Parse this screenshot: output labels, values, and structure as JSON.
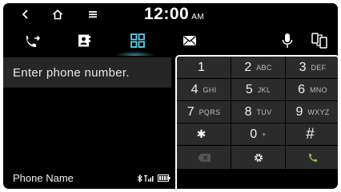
{
  "status_bar": {
    "back_icon": "chevron-left-icon",
    "home_icon": "home-icon",
    "menu_icon": "menu-icon",
    "time": "12:00",
    "ampm": "AM"
  },
  "tabs": [
    {
      "icon": "call-history-icon",
      "selected": false
    },
    {
      "icon": "contacts-icon",
      "selected": false
    },
    {
      "icon": "keypad-icon",
      "selected": true
    },
    {
      "icon": "message-icon",
      "selected": false
    },
    {
      "icon": "microphone-icon",
      "selected": false
    },
    {
      "icon": "switch-device-icon",
      "selected": false
    }
  ],
  "number_input": {
    "placeholder": "Enter phone number."
  },
  "device": {
    "name": "Phone Name",
    "bluetooth_icon": "bluetooth-icon",
    "signal_icon": "signal-icon",
    "battery_icon": "battery-icon"
  },
  "keypad": {
    "keys": [
      {
        "digit": "1",
        "letters": ""
      },
      {
        "digit": "2",
        "letters": "ABC"
      },
      {
        "digit": "3",
        "letters": "DEF"
      },
      {
        "digit": "4",
        "letters": "GHI"
      },
      {
        "digit": "5",
        "letters": "JKL"
      },
      {
        "digit": "6",
        "letters": "MNO"
      },
      {
        "digit": "7",
        "letters": "PQRS"
      },
      {
        "digit": "8",
        "letters": "TUV"
      },
      {
        "digit": "9",
        "letters": "WXYZ"
      },
      {
        "digit": "*",
        "letters": ""
      },
      {
        "digit": "0",
        "letters": "+"
      },
      {
        "digit": "#",
        "letters": ""
      }
    ],
    "actions": [
      {
        "icon": "backspace-icon"
      },
      {
        "icon": "settings-icon"
      },
      {
        "icon": "call-icon"
      }
    ],
    "call_color": "#8bc34a"
  }
}
